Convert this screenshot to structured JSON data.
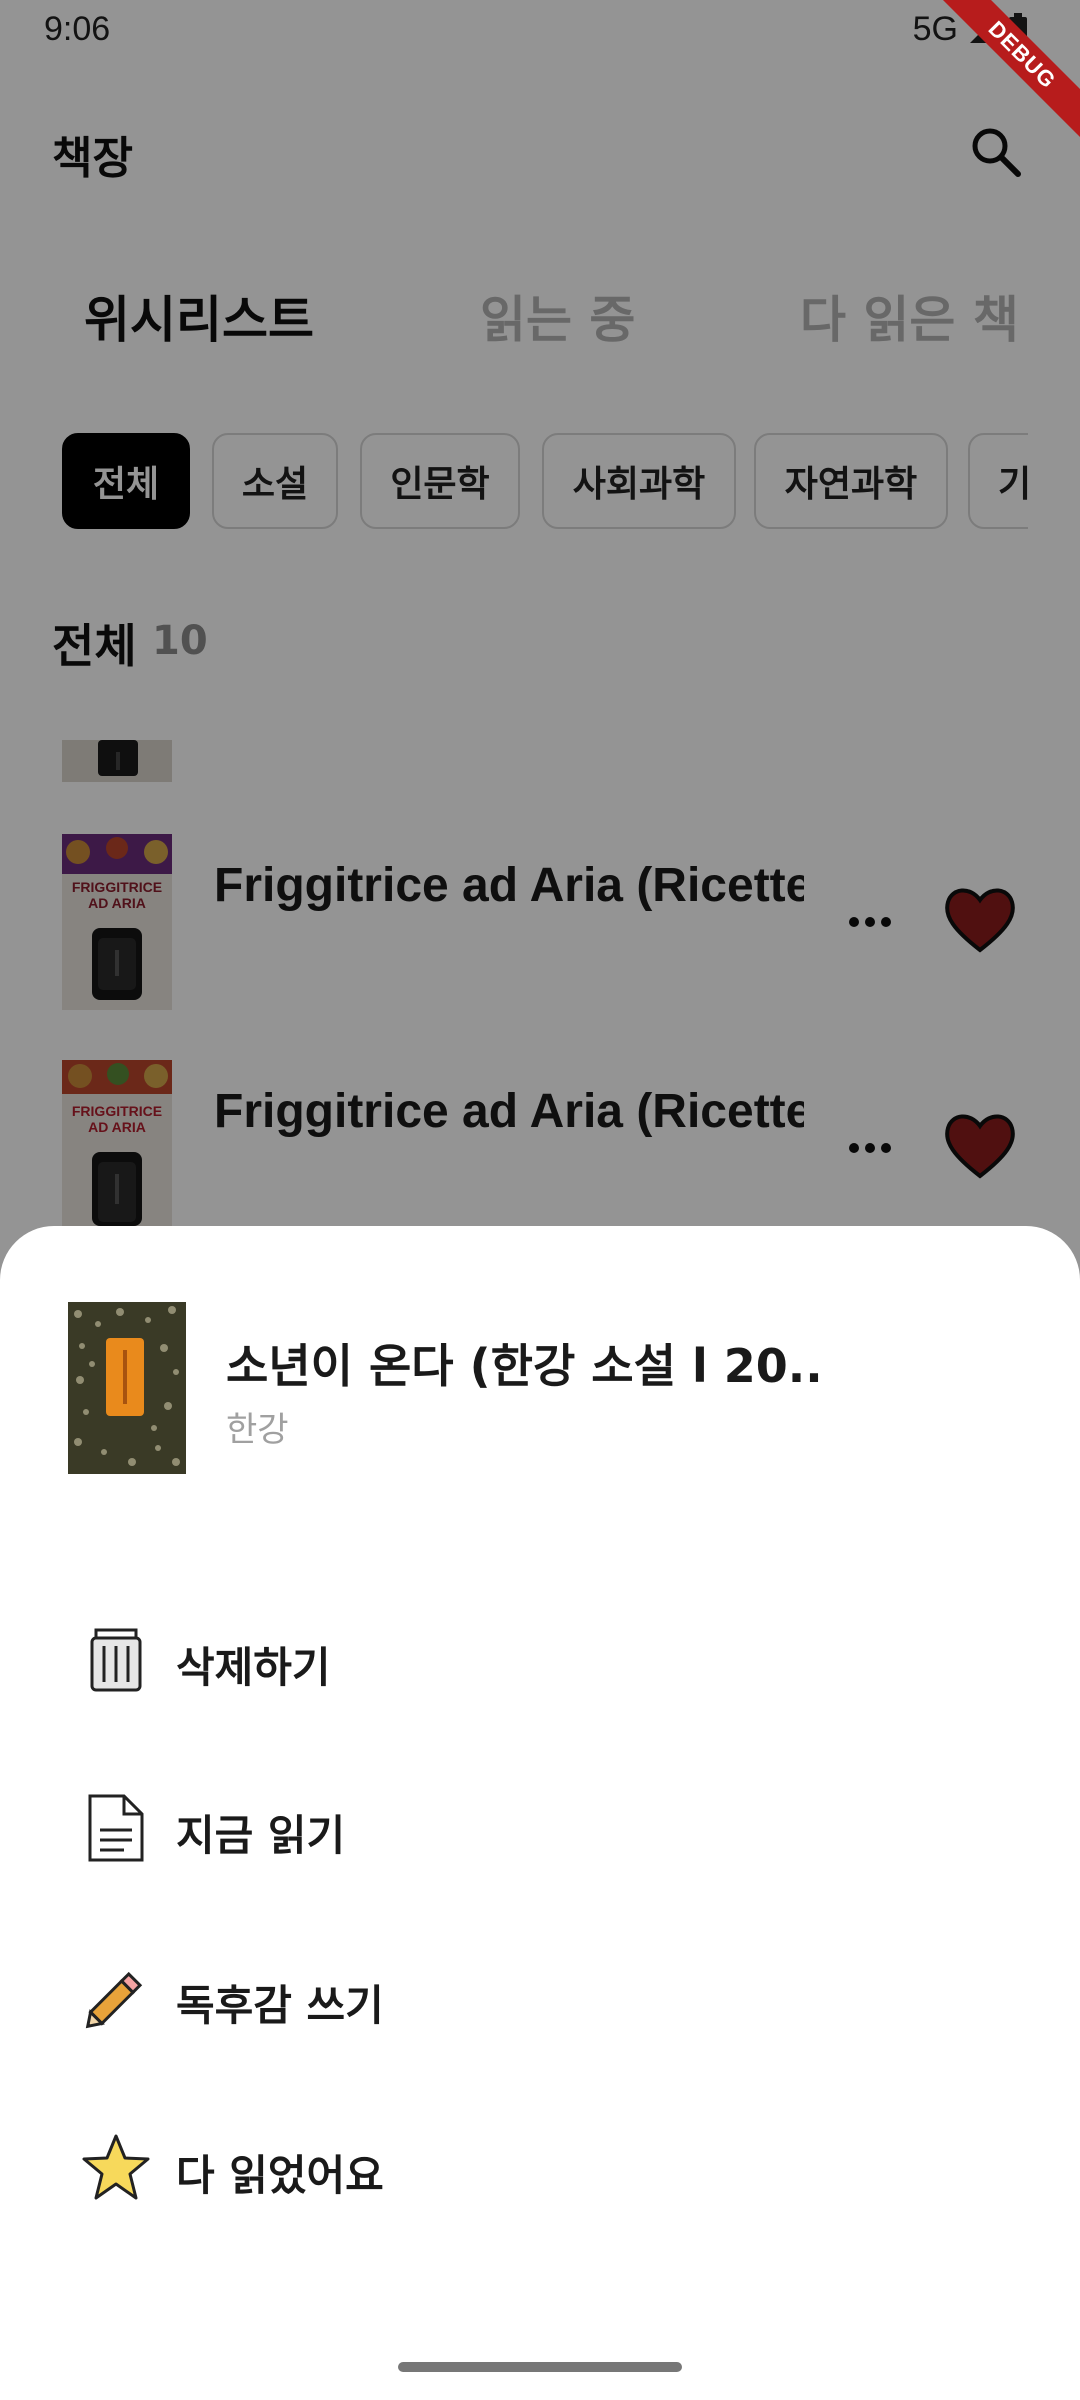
{
  "status_bar": {
    "time": "9:06",
    "network": "5G",
    "debug_label": "DEBUG"
  },
  "app_bar": {
    "title": "책장"
  },
  "tabs": [
    {
      "label": "위시리스트",
      "active": true
    },
    {
      "label": "읽는 중",
      "active": false
    },
    {
      "label": "다 읽은 책",
      "active": false
    }
  ],
  "chips": [
    {
      "label": "전체",
      "selected": true
    },
    {
      "label": "소설",
      "selected": false
    },
    {
      "label": "인문학",
      "selected": false
    },
    {
      "label": "사회과학",
      "selected": false
    },
    {
      "label": "자연과학",
      "selected": false
    },
    {
      "label": "기",
      "selected": false
    }
  ],
  "section": {
    "title": "전체",
    "count": "10"
  },
  "books": [
    {
      "title": "Friggitrice ad Aria (Ricette...",
      "favorite": true
    },
    {
      "title": "Friggitrice ad Aria (Ricette...",
      "favorite": true
    }
  ],
  "cover_text": {
    "line1": "FRIGGITRICE",
    "line2": "AD ARIA"
  },
  "bottom_sheet": {
    "book_title": "소년이 온다 (한강 소설 l 20...",
    "author": "한강",
    "actions": [
      {
        "label": "삭제하기",
        "icon": "trash-icon"
      },
      {
        "label": "지금 읽기",
        "icon": "document-icon"
      },
      {
        "label": "독후감 쓰기",
        "icon": "pencil-icon"
      },
      {
        "label": "다 읽었어요",
        "icon": "star-icon"
      }
    ]
  },
  "colors": {
    "heart": "#8b1c1c",
    "chip_selected": "#000000",
    "sheet_cover_background": "#3a3a26",
    "sheet_cover_label": "#e98a1c",
    "debug_ribbon": "#b71c1c",
    "star": "#f7d95b",
    "pencil": "#e8a33a"
  }
}
